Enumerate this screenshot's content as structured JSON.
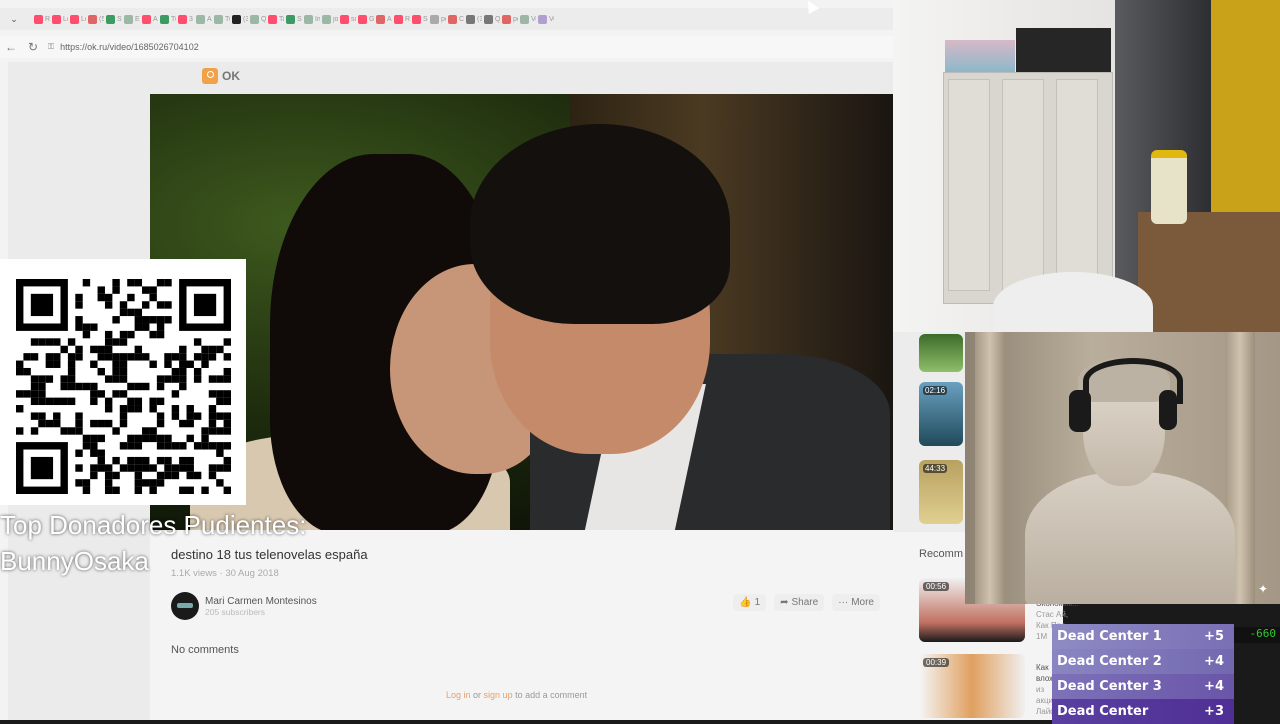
{
  "browser": {
    "url": "https://ok.ru/video/1685026704102",
    "tabs": [
      {
        "icon": "youtube-icon",
        "color": "#ff4d6d",
        "label": "Re"
      },
      {
        "icon": "youtube-icon",
        "color": "#ff4d6d",
        "label": "Lo"
      },
      {
        "icon": "youtube-icon",
        "color": "#ff4d6d",
        "label": "Lo"
      },
      {
        "icon": "mail-icon",
        "color": "#e06666",
        "label": "(5)"
      },
      {
        "icon": "k-icon",
        "color": "#3c9b63",
        "label": "Str"
      },
      {
        "icon": "doc-icon",
        "color": "#9cb7a6",
        "label": "El"
      },
      {
        "icon": "youtube-icon",
        "color": "#ff4d6d",
        "label": "Ah"
      },
      {
        "icon": "k-icon",
        "color": "#3c9b63",
        "label": "Tu"
      },
      {
        "icon": "youtube-icon",
        "color": "#ff4d6d",
        "label": "3"
      },
      {
        "icon": "doc-icon",
        "color": "#9cb7a6",
        "label": "A"
      },
      {
        "icon": "doc-icon",
        "color": "#9cb7a6",
        "label": "Tu"
      },
      {
        "icon": "tiktok-icon",
        "color": "#222222",
        "label": "(3)"
      },
      {
        "icon": "doc-icon",
        "color": "#9cb7a6",
        "label": "Q"
      },
      {
        "icon": "youtube-icon",
        "color": "#ff4d6d",
        "label": "Ta"
      },
      {
        "icon": "k-icon",
        "color": "#3c9b63",
        "label": "Str"
      },
      {
        "icon": "doc-icon",
        "color": "#9cb7a6",
        "label": "Im"
      },
      {
        "icon": "doc-icon",
        "color": "#9cb7a6",
        "label": "jos"
      },
      {
        "icon": "youtube-icon",
        "color": "#ff4d6d",
        "label": "so"
      },
      {
        "icon": "youtube-icon",
        "color": "#ff4d6d",
        "label": "Gu"
      },
      {
        "icon": "opera-icon",
        "color": "#e06666",
        "label": "A"
      },
      {
        "icon": "youtube-icon",
        "color": "#ff4d6d",
        "label": "Re"
      },
      {
        "icon": "youtube-icon",
        "color": "#ff4d6d",
        "label": "Se"
      },
      {
        "icon": "search-icon",
        "color": "#aaaaaa",
        "label": "pe"
      },
      {
        "icon": "chevron-icon",
        "color": "#e06666",
        "label": "Ca"
      },
      {
        "icon": "doc-icon",
        "color": "#777777",
        "label": "(3)"
      },
      {
        "icon": "doc-icon",
        "color": "#777777",
        "label": "Q"
      },
      {
        "icon": "vivaldi-icon",
        "color": "#e06666",
        "label": "pe"
      },
      {
        "icon": "doc-icon",
        "color": "#9cb7a6",
        "label": "Ve"
      },
      {
        "icon": "doc-icon",
        "color": "#b0a0d0",
        "label": "Ve"
      }
    ]
  },
  "ok": {
    "logo_text": "OK",
    "video_title": "destino 18 tus telenovelas españa",
    "meta": "1.1K views · 30 Aug 2018",
    "channel_name": "Mari Carmen Montesinos",
    "channel_subs": "205 subscribers",
    "like_label": "1",
    "share_label": "Share",
    "more_label": "More",
    "comments_label": "No comments",
    "login_link": "Log in",
    "or_text": " or ",
    "signup_link": "sign up",
    "comment_suffix": " to add a comment",
    "recommended_label": "Recomm",
    "side_thumbs": [
      {
        "duration": ""
      },
      {
        "duration": "02:16"
      },
      {
        "duration": "44:33"
      }
    ],
    "recommended": [
      {
        "duration": "00:56",
        "title": "Экономик...",
        "sub": "Стас Ай, Как Про...",
        "views": "1M"
      },
      {
        "duration": "00:39",
        "title": "Как влож...",
        "sub": "из акций...",
        "views": "Лайф"
      }
    ]
  },
  "overlay": {
    "donors_title": "Top Donadores Pudientes:",
    "donors_name": "BunnyOsaka",
    "leaderboard": [
      {
        "name": "Dead Center 1",
        "score": "+5"
      },
      {
        "name": "Dead Center 2",
        "score": "+4"
      },
      {
        "name": "Dead Center 3",
        "score": "+4"
      },
      {
        "name": "Dead Center",
        "score": "+3"
      }
    ],
    "delta": "-660"
  }
}
